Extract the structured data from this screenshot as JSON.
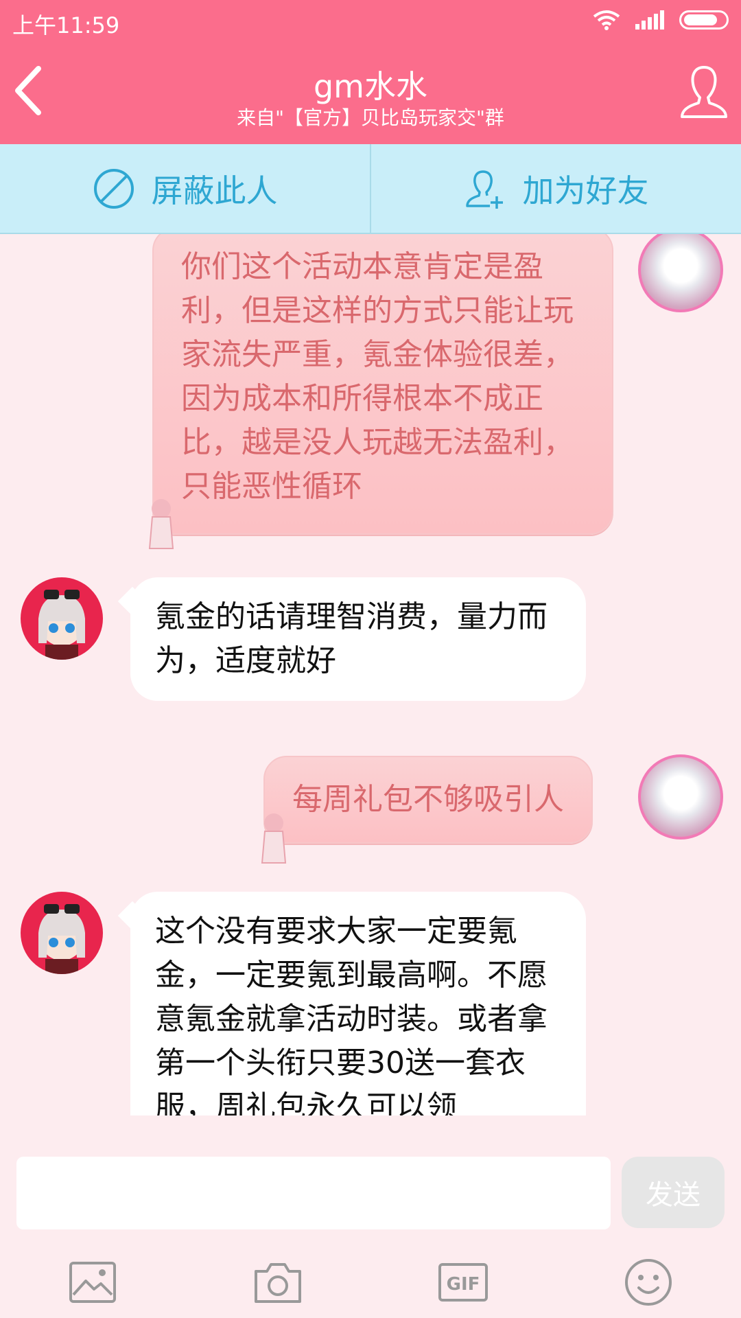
{
  "status_bar": {
    "time": "上午11:59"
  },
  "header": {
    "title": "gm水水",
    "subtitle": "来自\"【官方】贝比岛玩家交\"群"
  },
  "actions": {
    "block_label": "屏蔽此人",
    "add_friend_label": "加为好友"
  },
  "messages": [
    {
      "sender": "me",
      "text": "你们这个活动本意肯定是盈利，但是这样的方式只能让玩家流失严重，氪金体验很差，因为成本和所得根本不成正比，越是没人玩越无法盈利，只能恶性循环"
    },
    {
      "sender": "them",
      "text": "氪金的话请理智消费，量力而为，适度就好"
    },
    {
      "sender": "me",
      "text": "每周礼包不够吸引人"
    },
    {
      "sender": "them",
      "text": "这个没有要求大家一定要氪金，一定要氪到最高啊。不愿意氪金就拿活动时装。或者拿第一个头衔只要30送一套衣服，周礼包永久可以领"
    }
  ],
  "input": {
    "value": "",
    "send_label": "发送"
  },
  "colors": {
    "header": "#fb6d8c",
    "action_bar": "#c9eef9",
    "action_text": "#2ea7d2",
    "my_bubble": "#fcc8cb",
    "my_text": "#d9686d"
  },
  "icons": [
    "back-icon",
    "profile-icon",
    "block-icon",
    "add-friend-icon",
    "image-icon",
    "camera-icon",
    "gif-icon",
    "emoji-icon"
  ]
}
